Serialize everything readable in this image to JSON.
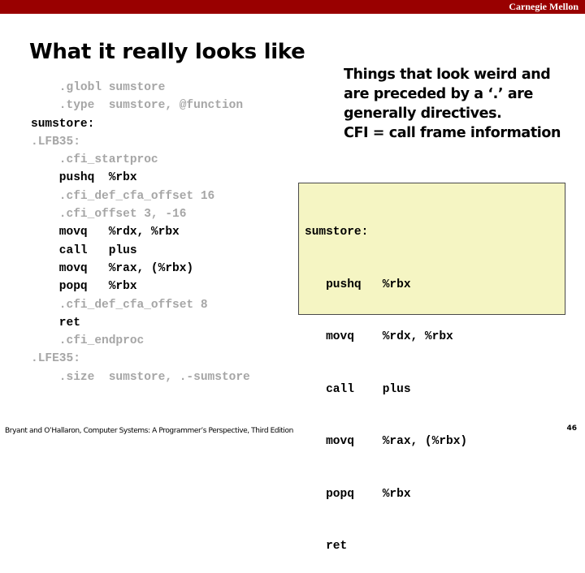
{
  "header": {
    "brand": "Carnegie Mellon",
    "bar_color": "#990000"
  },
  "slide": {
    "title": "What it really looks like",
    "page_number": "46"
  },
  "full_listing": [
    {
      "indent": "    ",
      "op": ".globl",
      "args": "sumstore",
      "kind": "directive"
    },
    {
      "indent": "    ",
      "op": ".type ",
      "args": "sumstore, @function",
      "kind": "directive"
    },
    {
      "indent": "",
      "op": "sumstore:",
      "args": "",
      "kind": "label"
    },
    {
      "indent": "",
      "op": ".LFB35:",
      "args": "",
      "kind": "directive"
    },
    {
      "indent": "    ",
      "op": ".cfi_startproc",
      "args": "",
      "kind": "directive"
    },
    {
      "indent": "    ",
      "op": "pushq ",
      "args": "%rbx",
      "kind": "instruction"
    },
    {
      "indent": "    ",
      "op": ".cfi_def_cfa_offset 16",
      "args": "",
      "kind": "directive"
    },
    {
      "indent": "    ",
      "op": ".cfi_offset 3, -16",
      "args": "",
      "kind": "directive"
    },
    {
      "indent": "    ",
      "op": "movq  ",
      "args": "%rdx, %rbx",
      "kind": "instruction"
    },
    {
      "indent": "    ",
      "op": "call  ",
      "args": "plus",
      "kind": "instruction"
    },
    {
      "indent": "    ",
      "op": "movq  ",
      "args": "%rax, (%rbx)",
      "kind": "instruction"
    },
    {
      "indent": "    ",
      "op": "popq  ",
      "args": "%rbx",
      "kind": "instruction"
    },
    {
      "indent": "    ",
      "op": ".cfi_def_cfa_offset 8",
      "args": "",
      "kind": "directive"
    },
    {
      "indent": "    ",
      "op": "ret",
      "args": "",
      "kind": "instruction"
    },
    {
      "indent": "    ",
      "op": ".cfi_endproc",
      "args": "",
      "kind": "directive"
    },
    {
      "indent": "",
      "op": ".LFE35:",
      "args": "",
      "kind": "directive"
    },
    {
      "indent": "    ",
      "op": ".size ",
      "args": "sumstore, .-sumstore",
      "kind": "directive"
    }
  ],
  "note": {
    "lines": [
      "Things that look weird and",
      "are preceded by a ‘.’ are",
      "generally directives.",
      "CFI = call frame information"
    ]
  },
  "clean_listing": {
    "background": "#f5f5c3",
    "lines": [
      "sumstore:",
      "   pushq   %rbx",
      "   movq    %rdx, %rbx",
      "   call    plus",
      "   movq    %rax, (%rbx)",
      "   popq    %rbx",
      "   ret"
    ]
  },
  "footer": {
    "citation": "Bryant and O’Hallaron, Computer Systems: A Programmer’s Perspective, Third Edition"
  },
  "colors": {
    "directive_text": "#a6a6a6",
    "instruction_text": "#000000"
  }
}
